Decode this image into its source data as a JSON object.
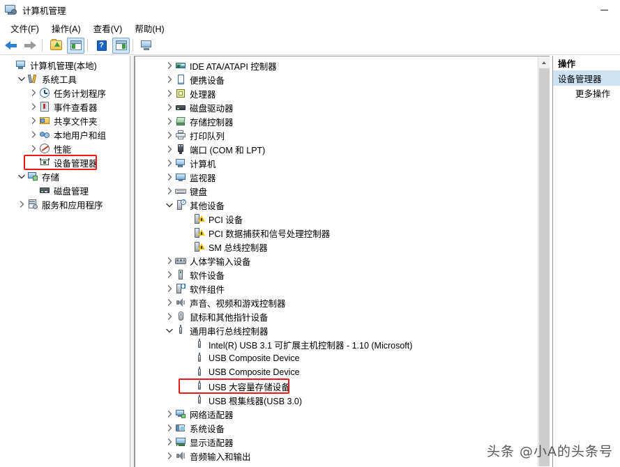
{
  "window": {
    "title": "计算机管理",
    "title_icon": "computer-management-icon",
    "minimize_label": "—"
  },
  "menubar": {
    "items": [
      {
        "text": "文件(F)",
        "name": "menu-file"
      },
      {
        "text": "操作(A)",
        "name": "menu-action"
      },
      {
        "text": "查看(V)",
        "name": "menu-view"
      },
      {
        "text": "帮助(H)",
        "name": "menu-help"
      }
    ]
  },
  "toolbar": {
    "buttons": [
      {
        "name": "back-arrow-icon",
        "type": "back"
      },
      {
        "name": "forward-arrow-icon",
        "type": "forward"
      },
      {
        "name": "up-folder-icon",
        "type": "folder"
      },
      {
        "name": "show-hide-console-tree-icon",
        "type": "pane-left",
        "selected": true
      },
      {
        "name": "help-icon",
        "type": "help",
        "glyph": "?"
      },
      {
        "name": "show-hide-action-pane-icon",
        "type": "pane-right",
        "selected": true
      },
      {
        "name": "connect-to-another-computer-icon",
        "type": "monitor"
      }
    ]
  },
  "sidebar": {
    "items": [
      {
        "label": "计算机管理(本地)",
        "indent": 0,
        "chev": "none",
        "icon": "computer-icon",
        "name": "tree-computer-management-local"
      },
      {
        "label": "系统工具",
        "indent": 1,
        "chev": "down",
        "icon": "system-tools-icon",
        "name": "tree-system-tools"
      },
      {
        "label": "任务计划程序",
        "indent": 2,
        "chev": "right",
        "icon": "task-scheduler-icon",
        "name": "tree-task-scheduler"
      },
      {
        "label": "事件查看器",
        "indent": 2,
        "chev": "right",
        "icon": "event-viewer-icon",
        "name": "tree-event-viewer"
      },
      {
        "label": "共享文件夹",
        "indent": 2,
        "chev": "right",
        "icon": "shared-folders-icon",
        "name": "tree-shared-folders"
      },
      {
        "label": "本地用户和组",
        "indent": 2,
        "chev": "right",
        "icon": "local-users-groups-icon",
        "name": "tree-local-users-and-groups"
      },
      {
        "label": "性能",
        "indent": 2,
        "chev": "right",
        "icon": "performance-icon",
        "name": "tree-performance"
      },
      {
        "label": "设备管理器",
        "indent": 2,
        "chev": "none",
        "icon": "device-manager-icon",
        "name": "tree-device-manager",
        "highlight": true
      },
      {
        "label": "存储",
        "indent": 1,
        "chev": "down",
        "icon": "storage-icon",
        "name": "tree-storage"
      },
      {
        "label": "磁盘管理",
        "indent": 2,
        "chev": "none",
        "icon": "disk-management-icon",
        "name": "tree-disk-management"
      },
      {
        "label": "服务和应用程序",
        "indent": 1,
        "chev": "right",
        "icon": "services-applications-icon",
        "name": "tree-services-and-applications"
      }
    ]
  },
  "devices": {
    "items": [
      {
        "label": "IDE ATA/ATAPI 控制器",
        "indent": 1,
        "chev": "right",
        "icon": "ide-controller-icon",
        "name": "device-ide-ata-atapi-controllers"
      },
      {
        "label": "便携设备",
        "indent": 1,
        "chev": "right",
        "icon": "portable-device-icon",
        "name": "device-portable-devices"
      },
      {
        "label": "处理器",
        "indent": 1,
        "chev": "right",
        "icon": "processor-icon",
        "name": "device-processors"
      },
      {
        "label": "磁盘驱动器",
        "indent": 1,
        "chev": "right",
        "icon": "disk-drive-icon",
        "name": "device-disk-drives"
      },
      {
        "label": "存储控制器",
        "indent": 1,
        "chev": "right",
        "icon": "storage-controller-icon",
        "name": "device-storage-controllers"
      },
      {
        "label": "打印队列",
        "indent": 1,
        "chev": "right",
        "icon": "print-queue-icon",
        "name": "device-print-queues"
      },
      {
        "label": "端口 (COM 和 LPT)",
        "indent": 1,
        "chev": "right",
        "icon": "port-icon",
        "name": "device-ports-com-lpt"
      },
      {
        "label": "计算机",
        "indent": 1,
        "chev": "right",
        "icon": "computer-icon",
        "name": "device-computer"
      },
      {
        "label": "监视器",
        "indent": 1,
        "chev": "right",
        "icon": "monitor-icon",
        "name": "device-monitors"
      },
      {
        "label": "键盘",
        "indent": 1,
        "chev": "right",
        "icon": "keyboard-icon",
        "name": "device-keyboards"
      },
      {
        "label": "其他设备",
        "indent": 1,
        "chev": "down",
        "icon": "other-devices-icon",
        "name": "device-other-devices"
      },
      {
        "label": "PCI 设备",
        "indent": 2,
        "chev": "none",
        "icon": "warning-device-icon",
        "name": "device-pci-device"
      },
      {
        "label": "PCI 数据捕获和信号处理控制器",
        "indent": 2,
        "chev": "none",
        "icon": "warning-device-icon",
        "name": "device-pci-data-acquisition"
      },
      {
        "label": "SM 总线控制器",
        "indent": 2,
        "chev": "none",
        "icon": "warning-device-icon",
        "name": "device-sm-bus-controller"
      },
      {
        "label": "人体学输入设备",
        "indent": 1,
        "chev": "right",
        "icon": "hid-icon",
        "name": "device-human-interface-devices"
      },
      {
        "label": "软件设备",
        "indent": 1,
        "chev": "right",
        "icon": "software-device-icon",
        "name": "device-software-devices"
      },
      {
        "label": "软件组件",
        "indent": 1,
        "chev": "right",
        "icon": "software-component-icon",
        "name": "device-software-components"
      },
      {
        "label": "声音、视频和游戏控制器",
        "indent": 1,
        "chev": "right",
        "icon": "sound-icon",
        "name": "device-sound-video-game-controllers"
      },
      {
        "label": "鼠标和其他指针设备",
        "indent": 1,
        "chev": "right",
        "icon": "mouse-icon",
        "name": "device-mice-and-pointing-devices"
      },
      {
        "label": "通用串行总线控制器",
        "indent": 1,
        "chev": "down",
        "icon": "usb-icon",
        "name": "device-universal-serial-bus-controllers"
      },
      {
        "label": "Intel(R) USB 3.1 可扩展主机控制器 - 1.10 (Microsoft)",
        "indent": 2,
        "chev": "none",
        "icon": "usb-icon",
        "name": "device-intel-usb-31-xhci"
      },
      {
        "label": "USB Composite Device",
        "indent": 2,
        "chev": "none",
        "icon": "usb-icon",
        "name": "device-usb-composite-device-1"
      },
      {
        "label": "USB Composite Device",
        "indent": 2,
        "chev": "none",
        "icon": "usb-icon",
        "name": "device-usb-composite-device-2"
      },
      {
        "label": "USB 大容量存储设备",
        "indent": 2,
        "chev": "none",
        "icon": "usb-icon",
        "name": "device-usb-mass-storage",
        "highlight": true
      },
      {
        "label": "USB 根集线器(USB 3.0)",
        "indent": 2,
        "chev": "none",
        "icon": "usb-icon",
        "name": "device-usb-root-hub-30"
      },
      {
        "label": "网络适配器",
        "indent": 1,
        "chev": "right",
        "icon": "network-adapter-icon",
        "name": "device-network-adapters"
      },
      {
        "label": "系统设备",
        "indent": 1,
        "chev": "right",
        "icon": "system-device-icon",
        "name": "device-system-devices"
      },
      {
        "label": "显示适配器",
        "indent": 1,
        "chev": "right",
        "icon": "display-adapter-icon",
        "name": "device-display-adapters"
      },
      {
        "label": "音频输入和输出",
        "indent": 1,
        "chev": "right",
        "icon": "audio-icon",
        "name": "device-audio-inputs-and-outputs"
      }
    ]
  },
  "actions_pane": {
    "header": "操作",
    "selected_item": "设备管理器",
    "more_actions": "更多操作"
  },
  "scrollbar": {
    "up_arrow": "scroll-up-arrow",
    "position_percent": 0
  },
  "watermark": {
    "text": "头条 @小A的头条号"
  },
  "colors": {
    "highlight_red": "#e81b1b",
    "selection_blue": "#cde2f3",
    "toolbar_selected": "#cfe6f7"
  }
}
